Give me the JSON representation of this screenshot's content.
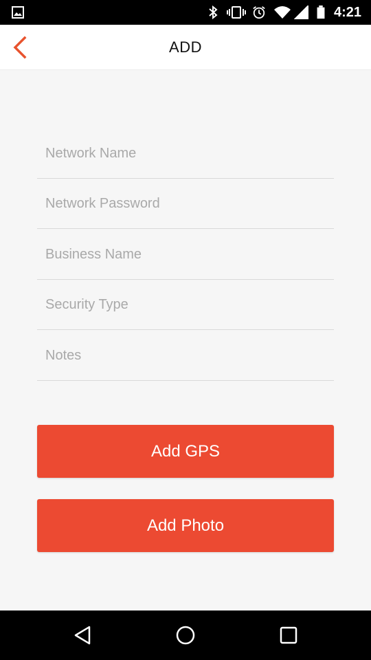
{
  "status_bar": {
    "time": "4:21",
    "icons": [
      "image-notification-icon",
      "bluetooth-icon",
      "vibrate-icon",
      "alarm-icon",
      "wifi-icon",
      "signal-icon",
      "battery-icon"
    ]
  },
  "header": {
    "title": "ADD",
    "back_icon": "chevron-left-icon",
    "accent_color": "#e8532e"
  },
  "form": {
    "fields": [
      {
        "placeholder": "Network Name",
        "value": ""
      },
      {
        "placeholder": "Network Password",
        "value": ""
      },
      {
        "placeholder": "Business Name",
        "value": ""
      },
      {
        "placeholder": "Security Type",
        "value": ""
      },
      {
        "placeholder": "Notes",
        "value": ""
      }
    ]
  },
  "actions": {
    "add_gps_label": "Add GPS",
    "add_photo_label": "Add Photo",
    "button_color": "#ec4a32"
  },
  "nav_bar": {
    "icons": [
      "back-triangle-icon",
      "home-circle-icon",
      "recents-square-icon"
    ]
  }
}
